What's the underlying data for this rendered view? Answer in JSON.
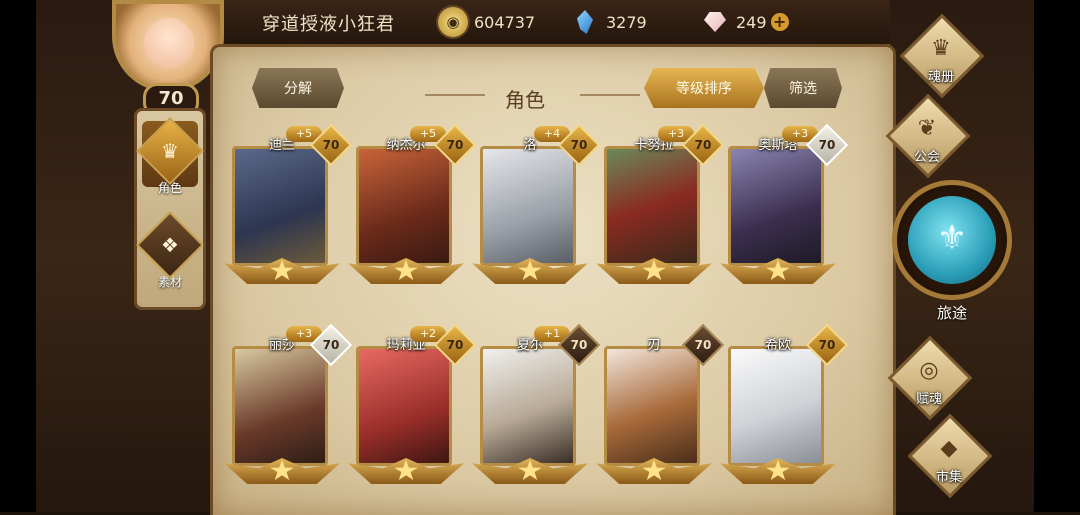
{
  "player": {
    "name": "穿道授液小狂君",
    "level": "70"
  },
  "resources": {
    "gold": "604737",
    "crystal": "3279",
    "gem": "249",
    "add_symbol": "+"
  },
  "tabs": [
    {
      "label": "角色"
    },
    {
      "label": "素材"
    }
  ],
  "panel": {
    "title": "角色",
    "decompose_label": "分解",
    "sort_label": "等级排序",
    "filter_label": "筛选"
  },
  "characters": [
    {
      "name": "迪兰",
      "level": "70",
      "plus": "+5",
      "level_style": "gold"
    },
    {
      "name": "纳杰尔",
      "level": "70",
      "plus": "+5",
      "level_style": "gold"
    },
    {
      "name": "洛",
      "level": "70",
      "plus": "+4",
      "level_style": "gold"
    },
    {
      "name": "卡努拉",
      "level": "70",
      "plus": "+3",
      "level_style": "gold"
    },
    {
      "name": "奥斯塔",
      "level": "70",
      "plus": "+3",
      "level_style": "white"
    },
    {
      "name": "丽莎",
      "level": "70",
      "plus": "+3",
      "level_style": "white"
    },
    {
      "name": "玛莉亚",
      "level": "70",
      "plus": "+2",
      "level_style": "gold"
    },
    {
      "name": "夏尔",
      "level": "70",
      "plus": "+1",
      "level_style": "dark"
    },
    {
      "name": "刃",
      "level": "70",
      "plus": "",
      "level_style": "dark"
    },
    {
      "name": "希欧",
      "level": "70",
      "plus": "",
      "level_style": "gold"
    }
  ],
  "right_menu": {
    "soul_book": "魂册",
    "guild": "公会",
    "travel": "旅途",
    "fu_soul": "赋魂",
    "market": "市集"
  },
  "icons": {
    "gold": "coin-icon",
    "crystal": "blue-crystal-icon",
    "gem": "pink-gem-icon",
    "role_tab": "helmet-icon",
    "material_tab": "wolf-head-icon",
    "soul_book": "crown-icon",
    "guild": "dragon-icon",
    "travel": "sword-emblem-icon",
    "fu_soul": "swirl-icon",
    "market": "box-icon"
  },
  "colors": {
    "accent_gold": "#d9a642",
    "parchment": "#e6d7b5",
    "frame_brown": "#6b4a25"
  }
}
